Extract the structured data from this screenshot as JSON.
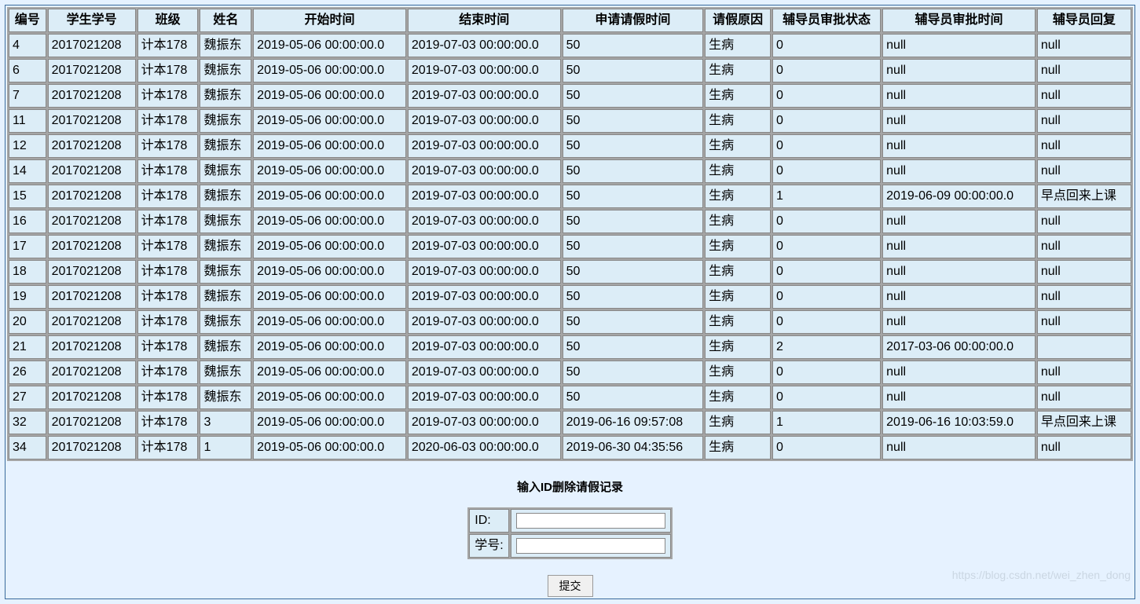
{
  "table": {
    "headers": [
      "编号",
      "学生学号",
      "班级",
      "姓名",
      "开始时间",
      "结束时间",
      "申请请假时间",
      "请假原因",
      "辅导员审批状态",
      "辅导员审批时间",
      "辅导员回复"
    ],
    "rows": [
      [
        "4",
        "2017021208",
        "计本178",
        "魏振东",
        "2019-05-06 00:00:00.0",
        "2019-07-03 00:00:00.0",
        "50",
        "生病",
        "0",
        "null",
        "null"
      ],
      [
        "6",
        "2017021208",
        "计本178",
        "魏振东",
        "2019-05-06 00:00:00.0",
        "2019-07-03 00:00:00.0",
        "50",
        "生病",
        "0",
        "null",
        "null"
      ],
      [
        "7",
        "2017021208",
        "计本178",
        "魏振东",
        "2019-05-06 00:00:00.0",
        "2019-07-03 00:00:00.0",
        "50",
        "生病",
        "0",
        "null",
        "null"
      ],
      [
        "11",
        "2017021208",
        "计本178",
        "魏振东",
        "2019-05-06 00:00:00.0",
        "2019-07-03 00:00:00.0",
        "50",
        "生病",
        "0",
        "null",
        "null"
      ],
      [
        "12",
        "2017021208",
        "计本178",
        "魏振东",
        "2019-05-06 00:00:00.0",
        "2019-07-03 00:00:00.0",
        "50",
        "生病",
        "0",
        "null",
        "null"
      ],
      [
        "14",
        "2017021208",
        "计本178",
        "魏振东",
        "2019-05-06 00:00:00.0",
        "2019-07-03 00:00:00.0",
        "50",
        "生病",
        "0",
        "null",
        "null"
      ],
      [
        "15",
        "2017021208",
        "计本178",
        "魏振东",
        "2019-05-06 00:00:00.0",
        "2019-07-03 00:00:00.0",
        "50",
        "生病",
        "1",
        "2019-06-09 00:00:00.0",
        "早点回来上课"
      ],
      [
        "16",
        "2017021208",
        "计本178",
        "魏振东",
        "2019-05-06 00:00:00.0",
        "2019-07-03 00:00:00.0",
        "50",
        "生病",
        "0",
        "null",
        "null"
      ],
      [
        "17",
        "2017021208",
        "计本178",
        "魏振东",
        "2019-05-06 00:00:00.0",
        "2019-07-03 00:00:00.0",
        "50",
        "生病",
        "0",
        "null",
        "null"
      ],
      [
        "18",
        "2017021208",
        "计本178",
        "魏振东",
        "2019-05-06 00:00:00.0",
        "2019-07-03 00:00:00.0",
        "50",
        "生病",
        "0",
        "null",
        "null"
      ],
      [
        "19",
        "2017021208",
        "计本178",
        "魏振东",
        "2019-05-06 00:00:00.0",
        "2019-07-03 00:00:00.0",
        "50",
        "生病",
        "0",
        "null",
        "null"
      ],
      [
        "20",
        "2017021208",
        "计本178",
        "魏振东",
        "2019-05-06 00:00:00.0",
        "2019-07-03 00:00:00.0",
        "50",
        "生病",
        "0",
        "null",
        "null"
      ],
      [
        "21",
        "2017021208",
        "计本178",
        "魏振东",
        "2019-05-06 00:00:00.0",
        "2019-07-03 00:00:00.0",
        "50",
        "生病",
        "2",
        "2017-03-06 00:00:00.0",
        ""
      ],
      [
        "26",
        "2017021208",
        "计本178",
        "魏振东",
        "2019-05-06 00:00:00.0",
        "2019-07-03 00:00:00.0",
        "50",
        "生病",
        "0",
        "null",
        "null"
      ],
      [
        "27",
        "2017021208",
        "计本178",
        "魏振东",
        "2019-05-06 00:00:00.0",
        "2019-07-03 00:00:00.0",
        "50",
        "生病",
        "0",
        "null",
        "null"
      ],
      [
        "32",
        "2017021208",
        "计本178",
        "3",
        "2019-05-06 00:00:00.0",
        "2019-07-03 00:00:00.0",
        "2019-06-16 09:57:08",
        "生病",
        "1",
        "2019-06-16 10:03:59.0",
        "早点回来上课"
      ],
      [
        "34",
        "2017021208",
        "计本178",
        "1",
        "2019-05-06 00:00:00.0",
        "2020-06-03 00:00:00.0",
        "2019-06-30 04:35:56",
        "生病",
        "0",
        "null",
        "null"
      ]
    ]
  },
  "form": {
    "title": "输入ID删除请假记录",
    "id_label": "ID:",
    "id_value": "",
    "student_no_label": "学号:",
    "student_no_value": "",
    "submit_label": "提交"
  },
  "watermark": "https://blog.csdn.net/wei_zhen_dong"
}
